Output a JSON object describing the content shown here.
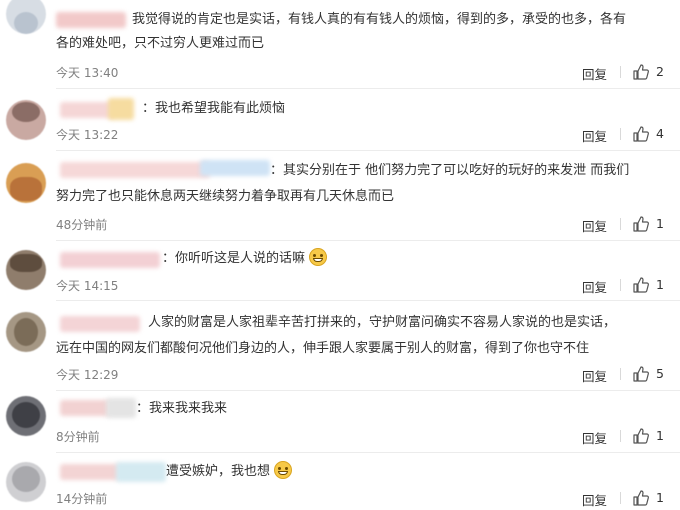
{
  "comments": [
    {
      "text_line1": "我觉得说的肯定也是实话，有钱人真的有有钱人的烦恼，得到的多，承受的也多，各有",
      "text_line2": "各的难处吧，只不过穷人更难过而已",
      "time": "今天 13:40",
      "reply": "回复",
      "likes": "2"
    },
    {
      "text_line1": "：我也希望我能有此烦恼",
      "time": "今天 13:22",
      "reply": "回复",
      "likes": "4"
    },
    {
      "text_line1": "：其实分别在于  他们努力完了可以吃好的玩好的来发泄  而我们",
      "text_line2": "努力完了也只能休息两天继续努力着争取再有几天休息而已",
      "time": "48分钟前",
      "reply": "回复",
      "likes": "1"
    },
    {
      "text_line1": "：你听听这是人说的话嘛",
      "emoji": "sweat-smile-emoji",
      "time": "今天 14:15",
      "reply": "回复",
      "likes": "1"
    },
    {
      "text_line1": "人家的财富是人家祖辈辛苦打拼来的，守护财富问确实不容易人家说的也是实话，",
      "text_line2": "远在中国的网友们都酸何况他们身边的人，伸手跟人家要属于别人的财富，得到了你也守不住",
      "time": "今天 12:29",
      "reply": "回复",
      "likes": "5"
    },
    {
      "text_line1": "：我来我来我来",
      "time": "8分钟前",
      "reply": "回复",
      "likes": "1"
    },
    {
      "text_line1": "遭受嫉妒，我也想",
      "emoji": "grin-emoji",
      "time": "14分钟前",
      "reply": "回复",
      "likes": "1"
    }
  ],
  "icons": {
    "like": "thumbs-up-icon"
  },
  "colors": {
    "text": "#333333",
    "meta": "#808080",
    "divider": "#ececec"
  }
}
